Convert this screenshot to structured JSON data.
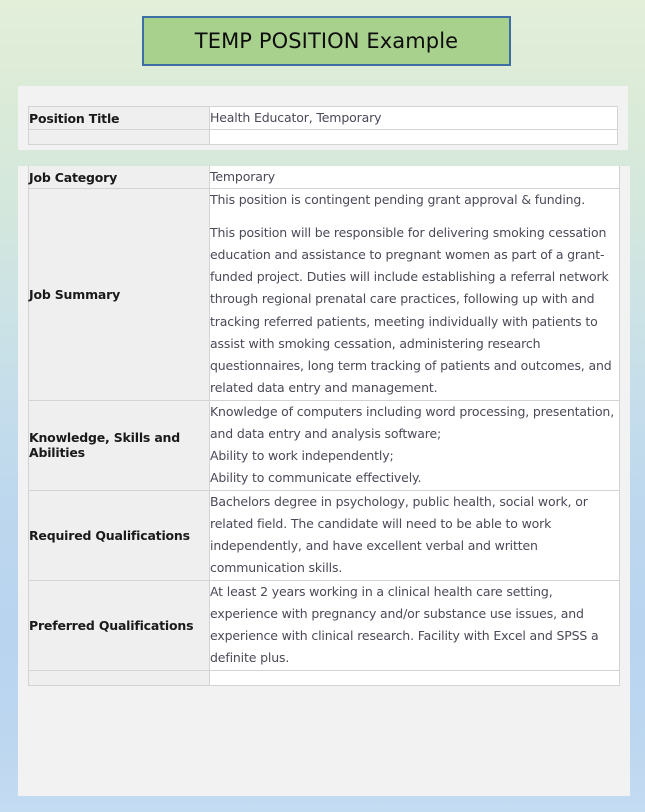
{
  "banner": {
    "title": "TEMP POSITION Example"
  },
  "top_panel": {
    "rows": [
      {
        "label": "Position Title",
        "value": "Health Educator, Temporary"
      }
    ]
  },
  "main_panel": {
    "rows": [
      {
        "label": "Job Category",
        "value": "Temporary"
      },
      {
        "label": "Job Summary",
        "paragraphs": [
          "This position is contingent pending grant approval & funding.",
          "This position will be responsible for delivering smoking cessation education and assistance to pregnant women as part of a grant-funded project. Duties will include establishing a referral network through regional prenatal care practices, following up with and tracking referred patients, meeting individually with patients to assist with smoking cessation, administering research questionnaires, long term tracking of patients and outcomes, and related data entry and management."
        ]
      },
      {
        "label": "Knowledge, Skills and Abilities",
        "lines": [
          "Knowledge of computers including word processing, presentation, and data entry and analysis software;",
          "Ability to work independently;",
          "Ability to communicate effectively."
        ]
      },
      {
        "label": "Required Qualifications",
        "value": "Bachelors degree in psychology, public health, social work, or related field. The candidate will need to be able to work independently, and have excellent verbal and written communication skills."
      },
      {
        "label": "Preferred Qualifications",
        "value": "At least 2 years working in a clinical health care setting, experience with pregnancy and/or substance use issues, and experience with clinical research. Facility with Excel and SPSS a definite plus."
      }
    ]
  },
  "colors": {
    "banner_fill": "#a9d18e",
    "banner_border": "#3d6fa5",
    "background_top": "#e3efd9",
    "background_bottom": "#bdd7ee",
    "label_cell_bg": "#efefef",
    "value_text": "#4a4a58",
    "table_border": "#d3d3d3"
  }
}
